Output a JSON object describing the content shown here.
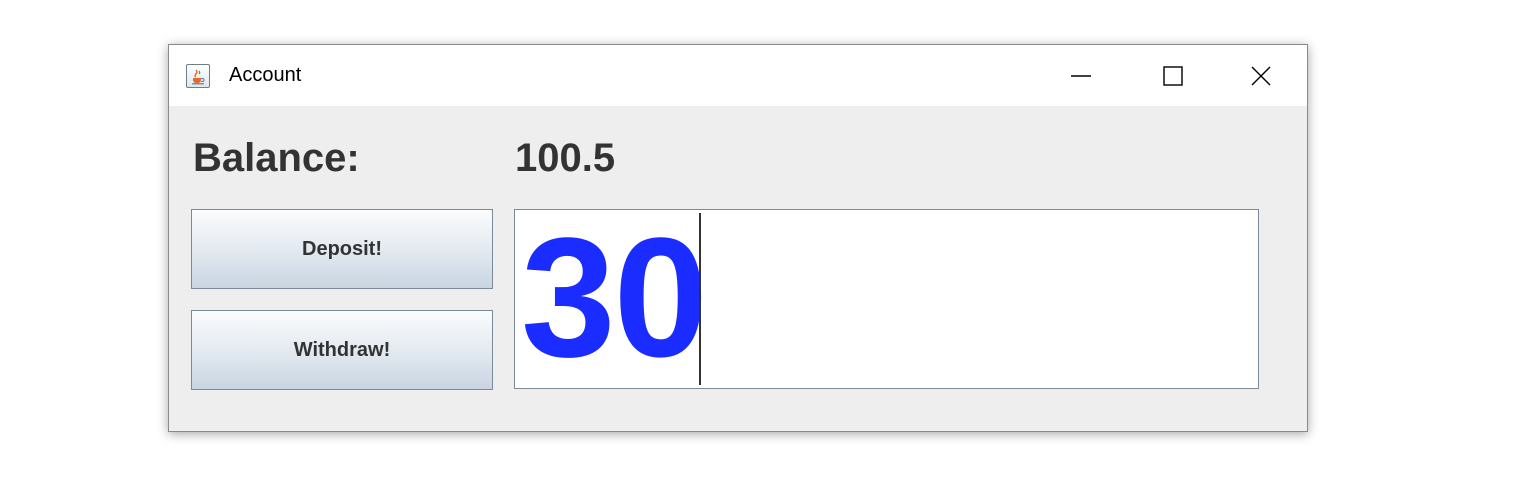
{
  "window": {
    "title": "Account",
    "icon": "java-coffee-cup-icon",
    "controls": {
      "minimize": "minimize-icon",
      "maximize": "maximize-icon",
      "close": "close-icon"
    }
  },
  "balance": {
    "label": "Balance:",
    "value": "100.5"
  },
  "buttons": {
    "deposit_label": "Deposit!",
    "withdraw_label": "Withdraw!"
  },
  "amount_input": {
    "value": "30",
    "text_color": "#1a2cff"
  }
}
